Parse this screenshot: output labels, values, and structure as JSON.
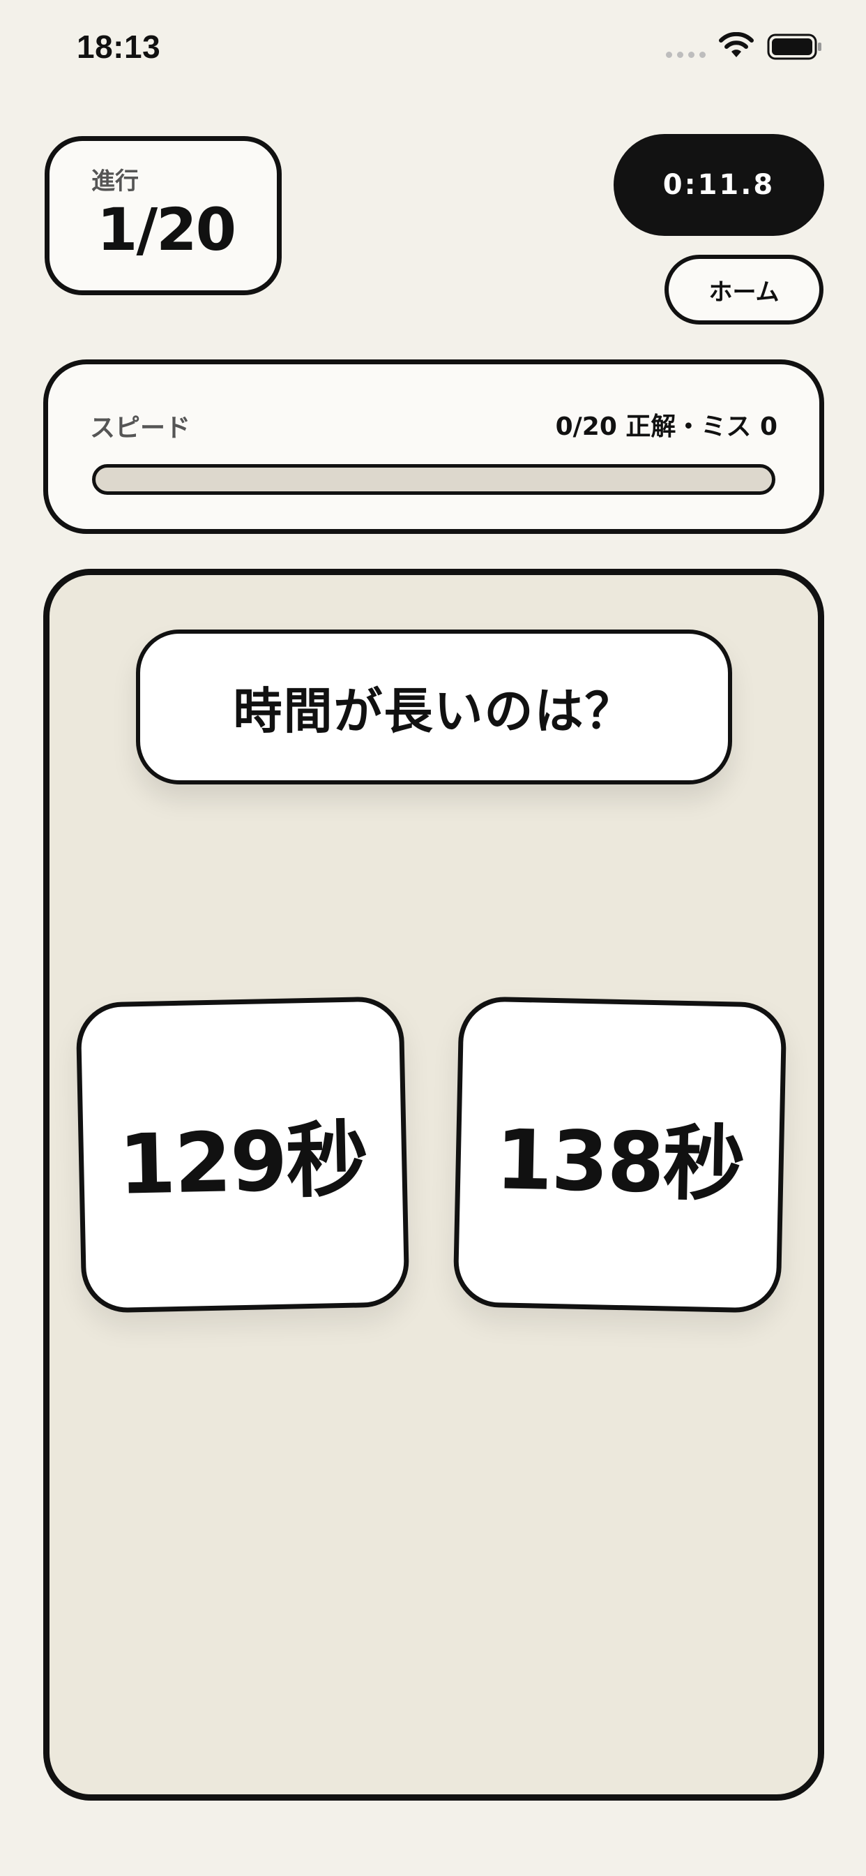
{
  "status_bar": {
    "time": "18:13",
    "icons": [
      "signal-dots-icon",
      "wifi-icon",
      "battery-icon"
    ]
  },
  "progress": {
    "label": "進行",
    "value": "1/20"
  },
  "timer": {
    "value": "0:11.8"
  },
  "home_button": {
    "label": "ホーム"
  },
  "speed": {
    "label": "スピード",
    "stats": "0/20 正解・ミス 0",
    "fill_fraction": 0
  },
  "question": {
    "text": "時間が長いのは？"
  },
  "choices": [
    {
      "label": "129秒"
    },
    {
      "label": "138秒"
    }
  ],
  "colors": {
    "background": "#f3f1ea",
    "card": "#fbfaf7",
    "game_area": "#ece8dc",
    "ink": "#111111",
    "track": "#ddd8cd"
  }
}
